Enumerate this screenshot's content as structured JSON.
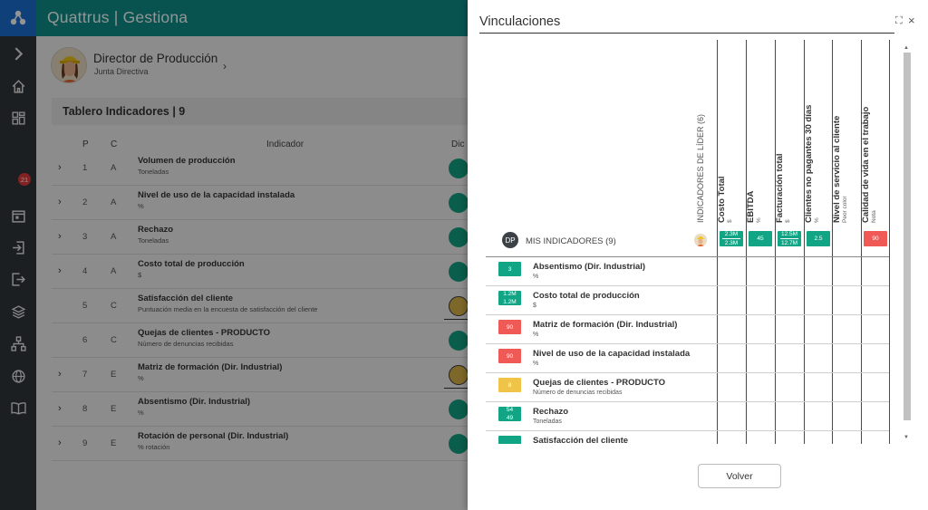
{
  "app": {
    "title": "Quattrus | Gestiona"
  },
  "rail": {
    "badge_count": "21",
    "icons": [
      "expand-icon",
      "home-icon",
      "dashboard-icon",
      "calendar-icon",
      "login-icon",
      "logout-icon",
      "layers-icon",
      "org-chart-icon",
      "globe-icon",
      "book-icon"
    ]
  },
  "profile": {
    "name": "Director de Producción",
    "role": "Junta Directiva"
  },
  "board": {
    "title": "Tablero Indicadores | 9",
    "columns": {
      "p": "P",
      "c": "C",
      "indicator": "Indicador",
      "dic": "Dic"
    },
    "rows": [
      {
        "p": "1",
        "c": "A",
        "name": "Volumen de producción",
        "unit": "Toneladas",
        "status": "green",
        "expandable": true
      },
      {
        "p": "2",
        "c": "A",
        "name": "Nivel de uso de la capacidad instalada",
        "unit": "%",
        "status": "green",
        "expandable": true
      },
      {
        "p": "3",
        "c": "A",
        "name": "Rechazo",
        "unit": "Toneladas",
        "status": "green",
        "expandable": true
      },
      {
        "p": "4",
        "c": "A",
        "name": "Costo total de producción",
        "unit": "$",
        "status": "green",
        "expandable": true
      },
      {
        "p": "5",
        "c": "C",
        "name": "Satisfacción del cliente",
        "unit": "Puntuación media en la encuesta de satisfacción del cliente",
        "status": "yellow",
        "expandable": false
      },
      {
        "p": "6",
        "c": "C",
        "name": "Quejas de clientes - PRODUCTO",
        "unit": "Número de denuncias recibidas",
        "status": "green",
        "expandable": false
      },
      {
        "p": "7",
        "c": "E",
        "name": "Matriz de formación (Dir. Industrial)",
        "unit": "%",
        "status": "yellow",
        "expandable": true
      },
      {
        "p": "8",
        "c": "E",
        "name": "Absentismo (Dir. Industrial)",
        "unit": "%",
        "status": "green",
        "expandable": true
      },
      {
        "p": "9",
        "c": "E",
        "name": "Rotación de personal (Dir. Industrial)",
        "unit": "% rotación",
        "status": "green",
        "expandable": true
      }
    ]
  },
  "panel": {
    "title": "Vinculaciones",
    "leader_label": "INDICADORES DE LÍDER (6)",
    "my_indicators_label": "MIS INDICADORES (9)",
    "user_initials": "DP",
    "columns": [
      {
        "title": "Costo Total",
        "unit": "$"
      },
      {
        "title": "EBITDA",
        "unit": "%"
      },
      {
        "title": "Facturación total",
        "unit": "$"
      },
      {
        "title": "Clientes no pagantes 30 días",
        "unit": "%"
      },
      {
        "title": "Nivel de servicio al cliente",
        "unit": "Peor color"
      },
      {
        "title": "Calidad de vida en el trabajo",
        "unit": "Nota"
      }
    ],
    "leader_values": [
      {
        "top": "2.3M",
        "bottom": "2.3M",
        "color": "green"
      },
      {
        "value": "45",
        "color": "green"
      },
      {
        "top": "12.5M",
        "bottom": "12.7M",
        "color": "green"
      },
      {
        "value": "2.5",
        "color": "green"
      },
      {
        "value": "",
        "color": "none"
      },
      {
        "value": "90",
        "color": "red"
      }
    ],
    "indicators": [
      {
        "name": "Absentismo (Dir. Industrial)",
        "unit": "%",
        "value": "3",
        "color": "green"
      },
      {
        "name": "Costo total de producción",
        "unit": "$",
        "top": "1.2M",
        "bottom": "1.2M",
        "color": "green"
      },
      {
        "name": "Matriz de formación (Dir. Industrial)",
        "unit": "%",
        "value": "90",
        "color": "red"
      },
      {
        "name": "Nivel de uso de la capacidad instalada",
        "unit": "%",
        "value": "90",
        "color": "red"
      },
      {
        "name": "Quejas de clientes - PRODUCTO",
        "unit": "Número de denuncias recibidas",
        "value": "8",
        "color": "yellow"
      },
      {
        "name": "Rechazo",
        "unit": "Toneladas",
        "top": "54",
        "bottom": "49",
        "color": "green"
      },
      {
        "name": "Satisfacción del cliente",
        "unit": "",
        "value": "",
        "color": "green"
      }
    ],
    "back_button": "Volver"
  },
  "colors": {
    "teal": "#0f8e8a",
    "green": "#12a585",
    "red": "#ef5a56",
    "yellow": "#efc448",
    "rail": "#31363b",
    "logo_bg": "#1a6fd0"
  }
}
